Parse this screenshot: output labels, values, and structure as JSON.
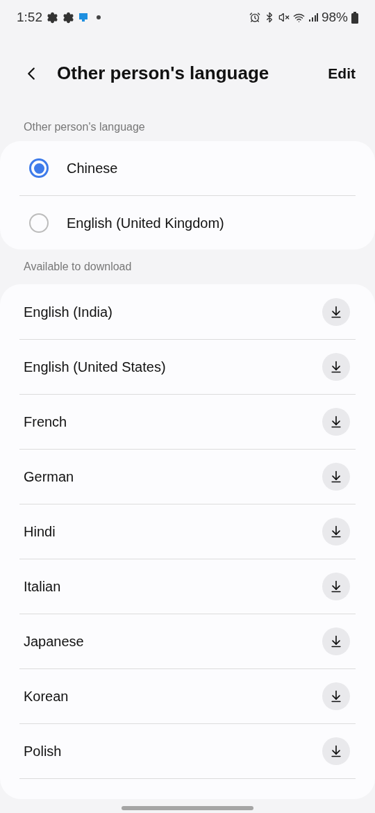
{
  "status_bar": {
    "time": "1:52",
    "battery": "98%"
  },
  "header": {
    "title": "Other person's language",
    "action": "Edit"
  },
  "selected_section": {
    "heading": "Other person's language",
    "options": [
      {
        "label": "Chinese",
        "selected": true
      },
      {
        "label": "English (United Kingdom)",
        "selected": false
      }
    ]
  },
  "download_section": {
    "heading": "Available to download",
    "items": [
      {
        "label": "English (India)"
      },
      {
        "label": "English (United States)"
      },
      {
        "label": "French"
      },
      {
        "label": "German"
      },
      {
        "label": "Hindi"
      },
      {
        "label": "Italian"
      },
      {
        "label": "Japanese"
      },
      {
        "label": "Korean"
      },
      {
        "label": "Polish"
      }
    ]
  }
}
